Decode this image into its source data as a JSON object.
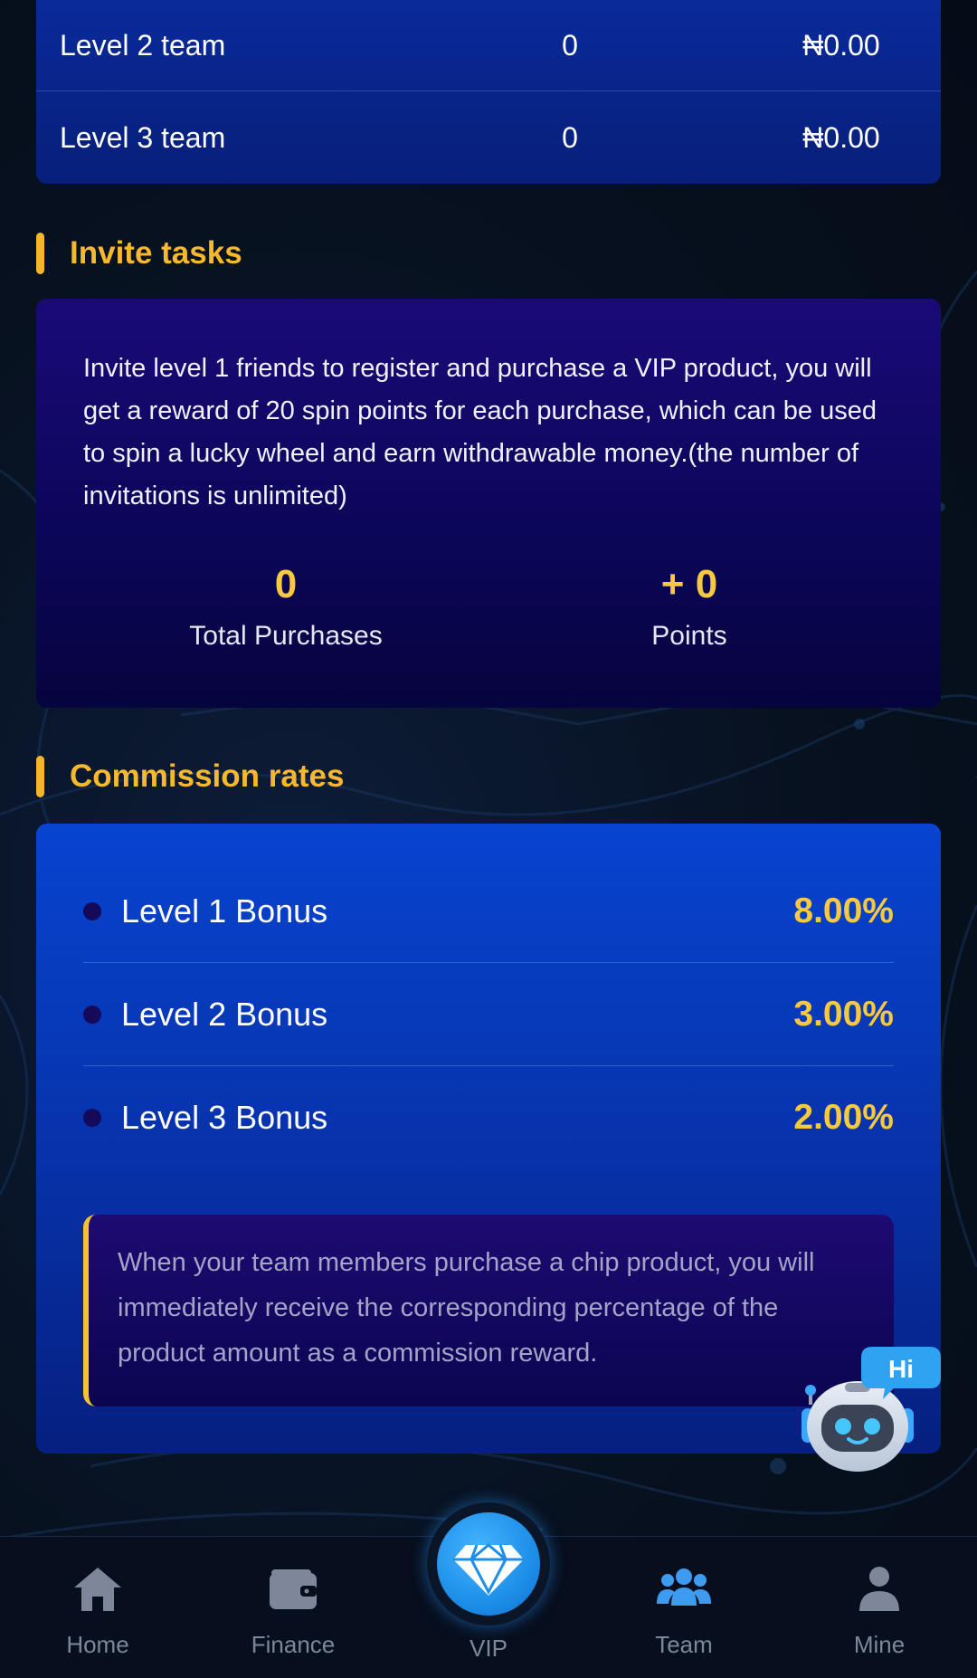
{
  "team_levels": [
    {
      "name": "Level 2 team",
      "count": "0",
      "amount": "₦0.00"
    },
    {
      "name": "Level 3 team",
      "count": "0",
      "amount": "₦0.00"
    }
  ],
  "invite_tasks": {
    "title": "Invite tasks",
    "description": "Invite level 1 friends to register and purchase a VIP product, you will get a reward of 20 spin points for each purchase, which can be used to spin a lucky wheel and earn withdrawable money.(the number of invitations is unlimited)",
    "stats": [
      {
        "value": "0",
        "label": "Total Purchases"
      },
      {
        "value": "+ 0",
        "label": "Points"
      }
    ]
  },
  "commission": {
    "title": "Commission rates",
    "rates": [
      {
        "label": "Level 1 Bonus",
        "value": "8.00%"
      },
      {
        "label": "Level 2 Bonus",
        "value": "3.00%"
      },
      {
        "label": "Level 3 Bonus",
        "value": "2.00%"
      }
    ],
    "note": "When your team members purchase a chip product, you will immediately receive the corresponding percentage of the product amount as a commission reward."
  },
  "chat_bot": {
    "bubble_text": "Hi",
    "icon": "robot-chat-icon"
  },
  "bottom_nav": {
    "items": [
      {
        "label": "Home",
        "icon": "home-icon",
        "active": false
      },
      {
        "label": "Finance",
        "icon": "wallet-icon",
        "active": false
      },
      {
        "label": "VIP",
        "icon": "diamond-icon",
        "active": false
      },
      {
        "label": "Team",
        "icon": "team-icon",
        "active": true
      },
      {
        "label": "Mine",
        "icon": "user-icon",
        "active": false
      }
    ]
  },
  "colors": {
    "accent_gold": "#f5b82e",
    "active_blue": "#3f9bf0",
    "card_blue": "#0744d0",
    "card_purple": "#1a0a78"
  }
}
